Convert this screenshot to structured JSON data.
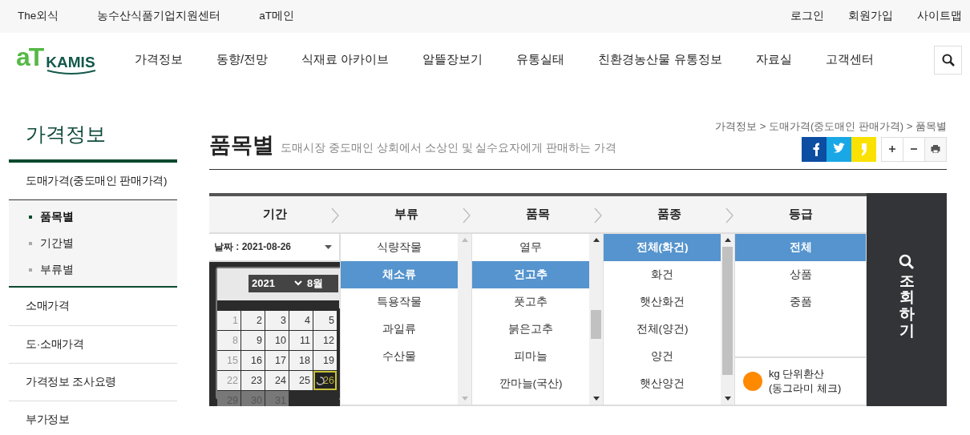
{
  "top_links": {
    "left": [
      "The외식",
      "농수산식품기업지원센터",
      "aT메인"
    ],
    "right": [
      "로그인",
      "회원가입",
      "사이트맵"
    ]
  },
  "logo": {
    "mark": "aT",
    "name": "KAMIS"
  },
  "nav": {
    "items": [
      "가격정보",
      "동향/전망",
      "식재료 아카이브",
      "알뜰장보기",
      "유통실태",
      "친환경농산물 유통정보",
      "자료실",
      "고객센터"
    ]
  },
  "sidebar": {
    "title": "가격정보",
    "items": [
      {
        "label": "도매가격(중도매인 판매가격)",
        "expanded": true,
        "children": [
          {
            "label": "품목별",
            "selected": true
          },
          {
            "label": "기간별",
            "selected": false
          },
          {
            "label": "부류별",
            "selected": false
          }
        ]
      },
      {
        "label": "소매가격",
        "expanded": false
      },
      {
        "label": "도·소매가격",
        "expanded": false
      },
      {
        "label": "가격정보 조사요령",
        "expanded": false
      },
      {
        "label": "부가정보",
        "expanded": false
      }
    ]
  },
  "breadcrumb": "가격정보 > 도매가격(중도매인 판매가격) > 품목별",
  "page": {
    "title": "품목별",
    "subtitle": "도매시장 중도매인 상회에서 소상인 및 실수요자에게 판매하는 가격"
  },
  "share": [
    {
      "kind": "facebook"
    },
    {
      "kind": "twitter"
    },
    {
      "kind": "kakao"
    }
  ],
  "tools": [
    {
      "kind": "zoom-in"
    },
    {
      "kind": "zoom-out"
    },
    {
      "kind": "print"
    }
  ],
  "search_panel": {
    "steps": [
      "기간",
      "부류",
      "품목",
      "품종",
      "등급"
    ],
    "period": {
      "date_label": "날짜 : 2021-08-26",
      "year": "2021",
      "month": "8월",
      "days": [
        {
          "day": "1",
          "kind": "sunday",
          "selected": false,
          "disabled": false
        },
        {
          "day": "2",
          "kind": "weekday",
          "selected": false,
          "disabled": false
        },
        {
          "day": "3",
          "kind": "weekday",
          "selected": false,
          "disabled": false
        },
        {
          "day": "4",
          "kind": "weekday",
          "selected": false,
          "disabled": false
        },
        {
          "day": "5",
          "kind": "weekday",
          "selected": false,
          "disabled": false
        },
        {
          "day": "8",
          "kind": "sunday",
          "selected": false,
          "disabled": false
        },
        {
          "day": "9",
          "kind": "weekday",
          "selected": false,
          "disabled": false
        },
        {
          "day": "10",
          "kind": "weekday",
          "selected": false,
          "disabled": false
        },
        {
          "day": "11",
          "kind": "weekday",
          "selected": false,
          "disabled": false
        },
        {
          "day": "12",
          "kind": "weekday",
          "selected": false,
          "disabled": false
        },
        {
          "day": "15",
          "kind": "sunday",
          "selected": false,
          "disabled": false
        },
        {
          "day": "16",
          "kind": "weekday",
          "selected": false,
          "disabled": false
        },
        {
          "day": "17",
          "kind": "weekday",
          "selected": false,
          "disabled": false
        },
        {
          "day": "18",
          "kind": "weekday",
          "selected": false,
          "disabled": false
        },
        {
          "day": "19",
          "kind": "weekday",
          "selected": false,
          "disabled": false
        },
        {
          "day": "22",
          "kind": "sunday",
          "selected": false,
          "disabled": false
        },
        {
          "day": "23",
          "kind": "weekday",
          "selected": false,
          "disabled": false
        },
        {
          "day": "24",
          "kind": "weekday",
          "selected": false,
          "disabled": false
        },
        {
          "day": "25",
          "kind": "weekday",
          "selected": false,
          "disabled": false
        },
        {
          "day": "26",
          "kind": "weekday",
          "selected": true,
          "disabled": false
        },
        {
          "day": "29",
          "kind": "sunday",
          "selected": false,
          "disabled": true
        },
        {
          "day": "30",
          "kind": "weekday",
          "selected": false,
          "disabled": true
        },
        {
          "day": "31",
          "kind": "weekday",
          "selected": false,
          "disabled": true
        }
      ]
    },
    "lists": [
      {
        "items": [
          {
            "label": "식량작물",
            "selected": false
          },
          {
            "label": "채소류",
            "selected": true
          },
          {
            "label": "특용작물",
            "selected": false
          },
          {
            "label": "과일류",
            "selected": false
          },
          {
            "label": "수산물",
            "selected": false
          }
        ]
      },
      {
        "items": [
          {
            "label": "열무",
            "selected": false
          },
          {
            "label": "건고추",
            "selected": true
          },
          {
            "label": "풋고추",
            "selected": false
          },
          {
            "label": "붉은고추",
            "selected": false
          },
          {
            "label": "피마늘",
            "selected": false
          },
          {
            "label": "깐마늘(국산)",
            "selected": false
          }
        ]
      },
      {
        "items": [
          {
            "label": "전체(화건)",
            "selected": true
          },
          {
            "label": "화건",
            "selected": false
          },
          {
            "label": "햇산화건",
            "selected": false
          },
          {
            "label": "전체(양건)",
            "selected": false
          },
          {
            "label": "양건",
            "selected": false
          },
          {
            "label": "햇산양건",
            "selected": false
          }
        ]
      },
      {
        "items": [
          {
            "label": "전체",
            "selected": true
          },
          {
            "label": "상품",
            "selected": false
          },
          {
            "label": "중품",
            "selected": false
          }
        ]
      }
    ],
    "unit_option": {
      "lines": [
        "kg 단위환산",
        "(동그라미 체크)"
      ]
    },
    "query_button": "조회하기"
  }
}
